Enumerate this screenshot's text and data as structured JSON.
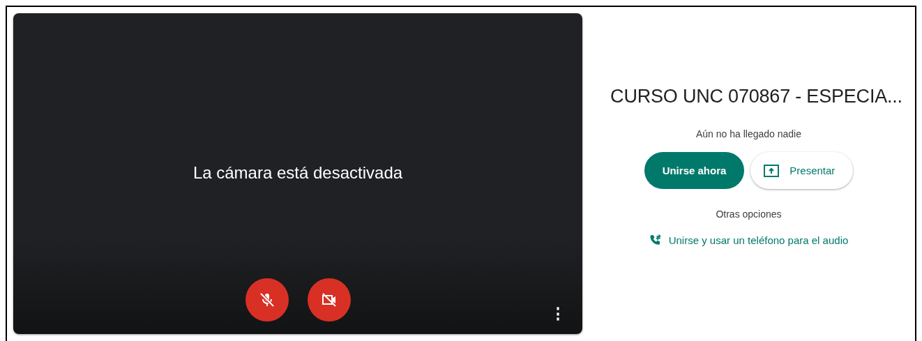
{
  "preview": {
    "message": "La cámara está desactivada",
    "controls": [
      {
        "kind": "microphone",
        "on": false
      },
      {
        "kind": "camera",
        "on": false
      }
    ],
    "more_options": "⋮"
  },
  "meeting": {
    "title": "CURSO UNC 070867 - ESPECIA...",
    "status": "Aún no ha llegado nadie",
    "buttons": [
      {
        "kind": "primary",
        "label": "Unirse ahora"
      },
      {
        "kind": "present",
        "label": "Presentar"
      }
    ],
    "other_options_label": "Otras opciones",
    "phone_link": "Unirse y usar un teléfono para el audio"
  }
}
